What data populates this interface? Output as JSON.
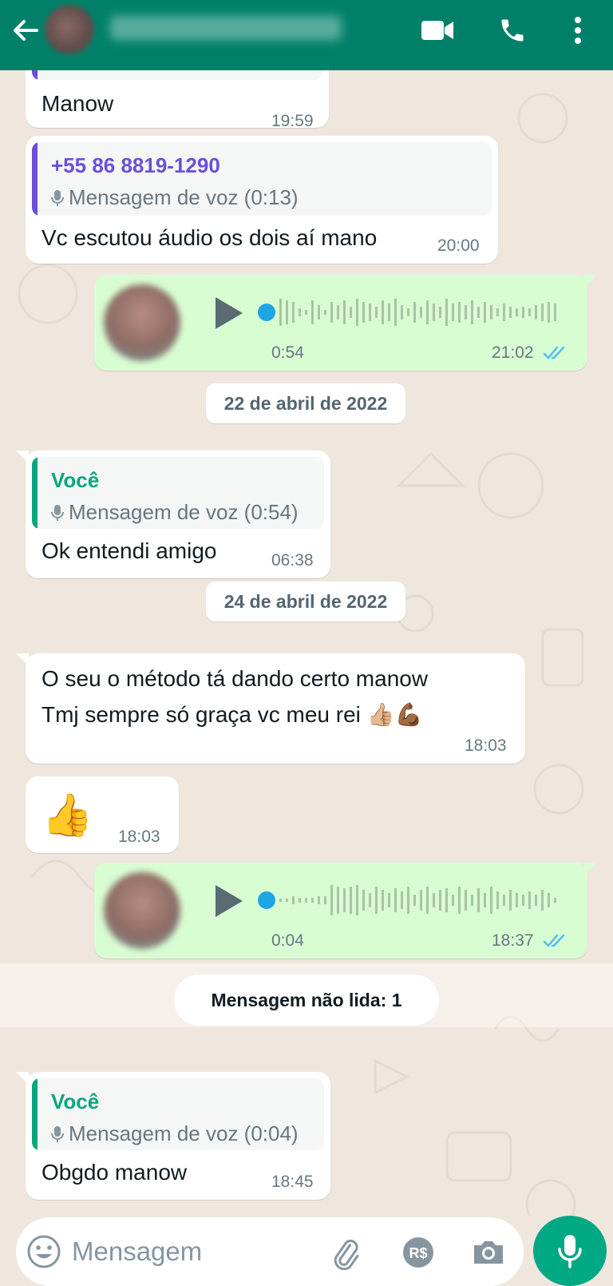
{
  "header": {
    "back_icon": "arrow-left-icon",
    "video_icon": "video-camera-icon",
    "call_icon": "phone-icon",
    "menu_icon": "more-vertical-icon",
    "color": "#008069"
  },
  "messages": [
    {
      "id": "m1",
      "dir": "in",
      "text": "Manow",
      "time": "19:59"
    },
    {
      "id": "m2",
      "dir": "in",
      "quote_name": "+55 86 8819-1290",
      "quote_text": "Mensagem de voz (0:13)",
      "text": "Vc escutou áudio os dois aí mano",
      "time": "20:00"
    },
    {
      "id": "m3",
      "dir": "out",
      "type": "voice",
      "duration": "0:54",
      "time": "21:02",
      "status": "read-double-check"
    },
    {
      "id": "d1",
      "type": "date",
      "text": "22 de abril de 2022"
    },
    {
      "id": "m4",
      "dir": "in",
      "quote_name": "Você",
      "quote_text": "Mensagem de voz (0:54)",
      "text": "Ok entendi amigo",
      "time": "06:38"
    },
    {
      "id": "d2",
      "type": "date",
      "text": "24 de abril de 2022"
    },
    {
      "id": "m5",
      "dir": "in",
      "text_line1": "O seu o método tá dando certo manow",
      "text_line2": "Tmj sempre só graça vc meu rei 👍🏼💪🏾",
      "time": "18:03"
    },
    {
      "id": "m6",
      "dir": "in",
      "text": "👍",
      "time": "18:03"
    },
    {
      "id": "m7",
      "dir": "out",
      "type": "voice",
      "duration": "0:04",
      "time": "18:37",
      "status": "read-double-check"
    },
    {
      "id": "u1",
      "type": "unread",
      "text": "Mensagem não lida: 1"
    },
    {
      "id": "m8",
      "dir": "in",
      "quote_name": "Você",
      "quote_text": "Mensagem de voz (0:04)",
      "text": "Obgdo manow",
      "time": "18:45"
    }
  ],
  "input": {
    "placeholder": "Mensagem",
    "emoji_icon": "emoji-icon",
    "attach_icon": "paperclip-icon",
    "pay_icon": "payment-icon",
    "camera_icon": "camera-icon",
    "mic_icon": "microphone-icon",
    "pay_label": "R$"
  },
  "colors": {
    "quote_contact": "#6b4fd8",
    "quote_self": "#06a77d",
    "bar_contact": "#6b4fd8",
    "bar_self": "#06a77d",
    "tick_read": "#53bdeb",
    "voice_dot": "#1ea5e6"
  }
}
